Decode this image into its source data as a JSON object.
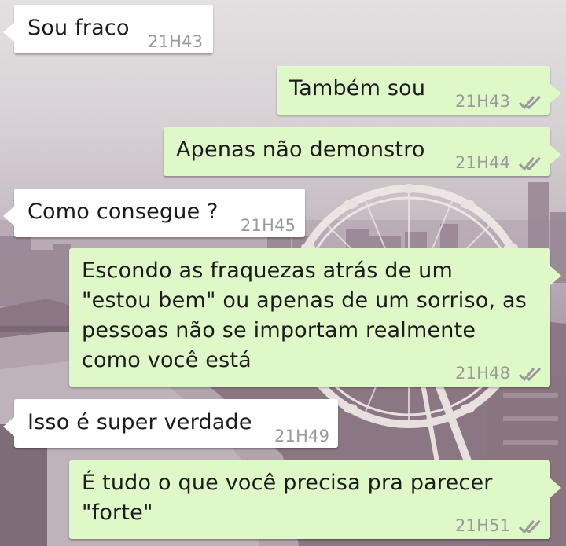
{
  "colors": {
    "incoming_bubble": "#ffffff",
    "outgoing_bubble": "#dff8c8",
    "timestamp": "#9a9a9a",
    "read_ticks": "#9a9a9a"
  },
  "icons": {
    "read_receipt": "double-check-icon"
  },
  "messages": [
    {
      "direction": "incoming",
      "text": "Sou fraco",
      "time": "21H43"
    },
    {
      "direction": "outgoing",
      "text": "Também sou",
      "time": "21H43",
      "read": true
    },
    {
      "direction": "outgoing",
      "text": "Apenas não demonstro",
      "time": "21H44",
      "read": true
    },
    {
      "direction": "incoming",
      "text": "Como consegue ?",
      "time": "21H45"
    },
    {
      "direction": "outgoing",
      "text": "Escondo as fraquezas atrás de um\n\"estou bem\" ou apenas de um sorriso, as\npessoas não se importam realmente\ncomo você está",
      "time": "21H48",
      "read": true
    },
    {
      "direction": "incoming",
      "text": "Isso é super verdade",
      "time": "21H49"
    },
    {
      "direction": "outgoing",
      "text": "É tudo o que você precisa pra parecer\n\"forte\"",
      "time": "21H51",
      "read": true
    }
  ]
}
